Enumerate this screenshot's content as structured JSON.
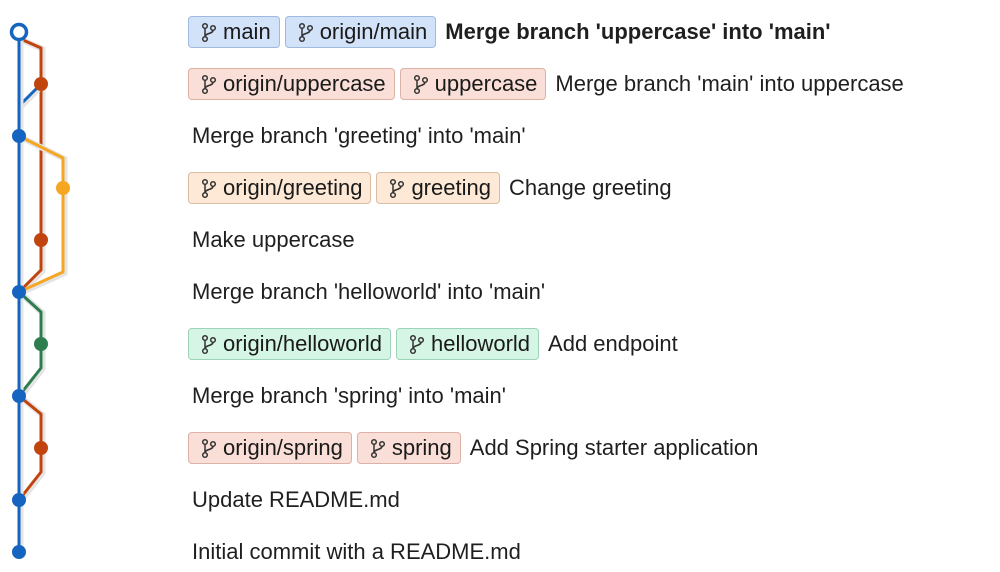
{
  "colors": {
    "main": "#1565c0",
    "uppercase": "#c1440e",
    "greeting": "#f5a623",
    "helloworld": "#2e7d4f",
    "spring": "#c1440e"
  },
  "branch_icon": "git-branch-icon",
  "commits": [
    {
      "message": "Merge branch 'uppercase' into 'main'",
      "bold": true,
      "refs": [
        {
          "label": "main",
          "color": "blue"
        },
        {
          "label": "origin/main",
          "color": "blue"
        }
      ]
    },
    {
      "message": "Merge branch 'main' into uppercase",
      "bold": false,
      "refs": [
        {
          "label": "origin/uppercase",
          "color": "red"
        },
        {
          "label": "uppercase",
          "color": "red"
        }
      ]
    },
    {
      "message": "Merge branch 'greeting' into 'main'",
      "bold": false,
      "refs": []
    },
    {
      "message": "Change greeting",
      "bold": false,
      "refs": [
        {
          "label": "origin/greeting",
          "color": "orange"
        },
        {
          "label": "greeting",
          "color": "orange"
        }
      ]
    },
    {
      "message": "Make uppercase",
      "bold": false,
      "refs": []
    },
    {
      "message": "Merge branch 'helloworld' into 'main'",
      "bold": false,
      "refs": []
    },
    {
      "message": "Add endpoint",
      "bold": false,
      "refs": [
        {
          "label": "origin/helloworld",
          "color": "green"
        },
        {
          "label": "helloworld",
          "color": "green"
        }
      ]
    },
    {
      "message": "Merge branch 'spring' into 'main'",
      "bold": false,
      "refs": []
    },
    {
      "message": "Add Spring starter application",
      "bold": false,
      "refs": [
        {
          "label": "origin/spring",
          "color": "red"
        },
        {
          "label": "spring",
          "color": "red"
        }
      ]
    },
    {
      "message": "Update README.md",
      "bold": false,
      "refs": []
    },
    {
      "message": "Initial commit with a README.md",
      "bold": false,
      "refs": []
    }
  ]
}
